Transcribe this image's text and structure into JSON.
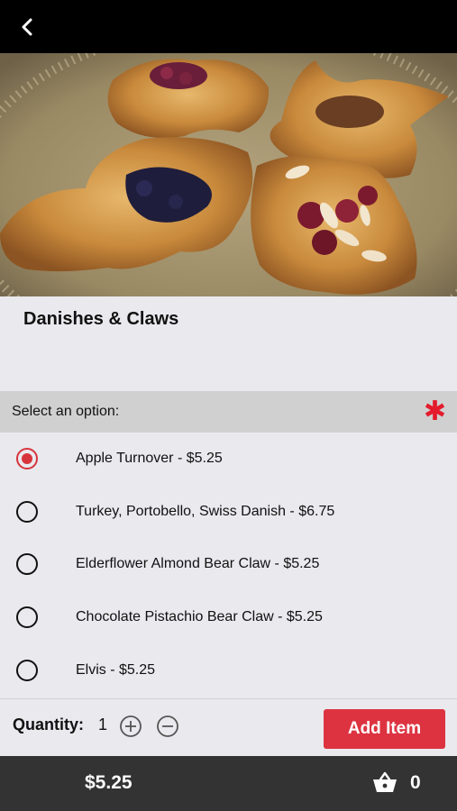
{
  "header": {
    "back_icon": "chevron-left-icon"
  },
  "hero": {
    "image": "pastry-photo-danishes-and-claws"
  },
  "item": {
    "title": "Danishes & Claws"
  },
  "options_section": {
    "label": "Select an option:",
    "required_marker": "✱",
    "required_color": "#e31b2c",
    "options": [
      {
        "label": "Apple Turnover - $5.25",
        "selected": true
      },
      {
        "label": "Turkey, Portobello, Swiss Danish - $6.75",
        "selected": false
      },
      {
        "label": "Elderflower Almond Bear Claw - $5.25",
        "selected": false
      },
      {
        "label": "Chocolate Pistachio Bear Claw - $5.25",
        "selected": false
      },
      {
        "label": "Elvis - $5.25",
        "selected": false
      }
    ]
  },
  "quantity": {
    "label": "Quantity:",
    "value": "1",
    "increment_icon": "plus-circle-icon",
    "decrement_icon": "minus-circle-icon"
  },
  "add_button": {
    "label": "Add Item",
    "color": "#dd3340"
  },
  "footer": {
    "total": "$5.25",
    "cart_icon": "basket-icon",
    "cart_count": "0"
  }
}
